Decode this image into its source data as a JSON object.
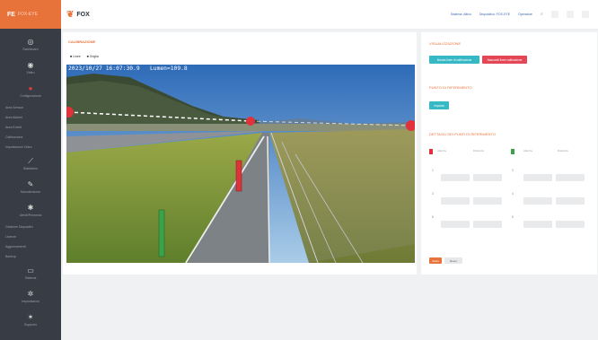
{
  "sidebar": {
    "brand": "FE",
    "brand_sub": "FOX-EYE",
    "icon_items": [
      {
        "icon": "dashboard-icon",
        "glyph": "◎",
        "label": "Dashboard"
      },
      {
        "icon": "camera-icon",
        "glyph": "◉",
        "label": "Video"
      },
      {
        "icon": "settings-icon",
        "glyph": "●",
        "label": "Configurazione"
      }
    ],
    "sub_items": [
      "Area Sensori",
      "Area Allarmi",
      "Area Eventi",
      "Calibrazione",
      "Impostazioni Video"
    ],
    "icon_items_2": [
      {
        "icon": "chart-icon",
        "glyph": "⟋",
        "label": "Statistiche"
      },
      {
        "icon": "wrench-icon",
        "glyph": "✎",
        "label": "Manutenzione"
      },
      {
        "icon": "gear-icon",
        "glyph": "✱",
        "label": "Utenti/Permessi"
      }
    ],
    "sub_items_2": [
      "Gestione Dispositivi",
      "Licenze",
      "Aggiornamenti",
      "Backup"
    ],
    "icon_items_3": [
      {
        "icon": "monitor-icon",
        "glyph": "▭",
        "label": "Sistema"
      },
      {
        "icon": "cog-icon",
        "glyph": "✲",
        "label": "Impostazioni"
      },
      {
        "icon": "help-icon",
        "glyph": "✶",
        "label": "Supporto"
      }
    ]
  },
  "topbar": {
    "logo_mark": "❦",
    "logo_text": "FOX",
    "status_label": "Sistema: Attivo",
    "status_value": "Dispositivo: FOX-EYE",
    "user": "Operatore",
    "lang": "IT"
  },
  "calibration": {
    "title": "CALIBRAZIONE",
    "tools": [
      "■ Linee",
      "■ Griglia"
    ],
    "osd_datetime": "2023/10/27  16:07:30.9",
    "osd_lumen": "Lumen=109.8"
  },
  "right_panel": {
    "section1_title": "VISUALIZZAZIONE",
    "btn_show": "Mostra linee di calibrazione",
    "btn_hide": "Nascondi linee calibrazione",
    "section2_title": "PUNTO DI RIFERIMENTO",
    "btn_point": "Imposta",
    "section3_title": "DETTAGLI DEI PUNTI DI RIFERIMENTO",
    "point_labels": [
      "Altezza",
      "Distanza"
    ],
    "marker_colors": {
      "red": "#e0323a",
      "green": "#3aa34a"
    },
    "rows": [
      "1",
      "2",
      "3",
      "4",
      "5",
      "6"
    ],
    "btn_save": "Salva",
    "btn_reset": "Reset"
  }
}
